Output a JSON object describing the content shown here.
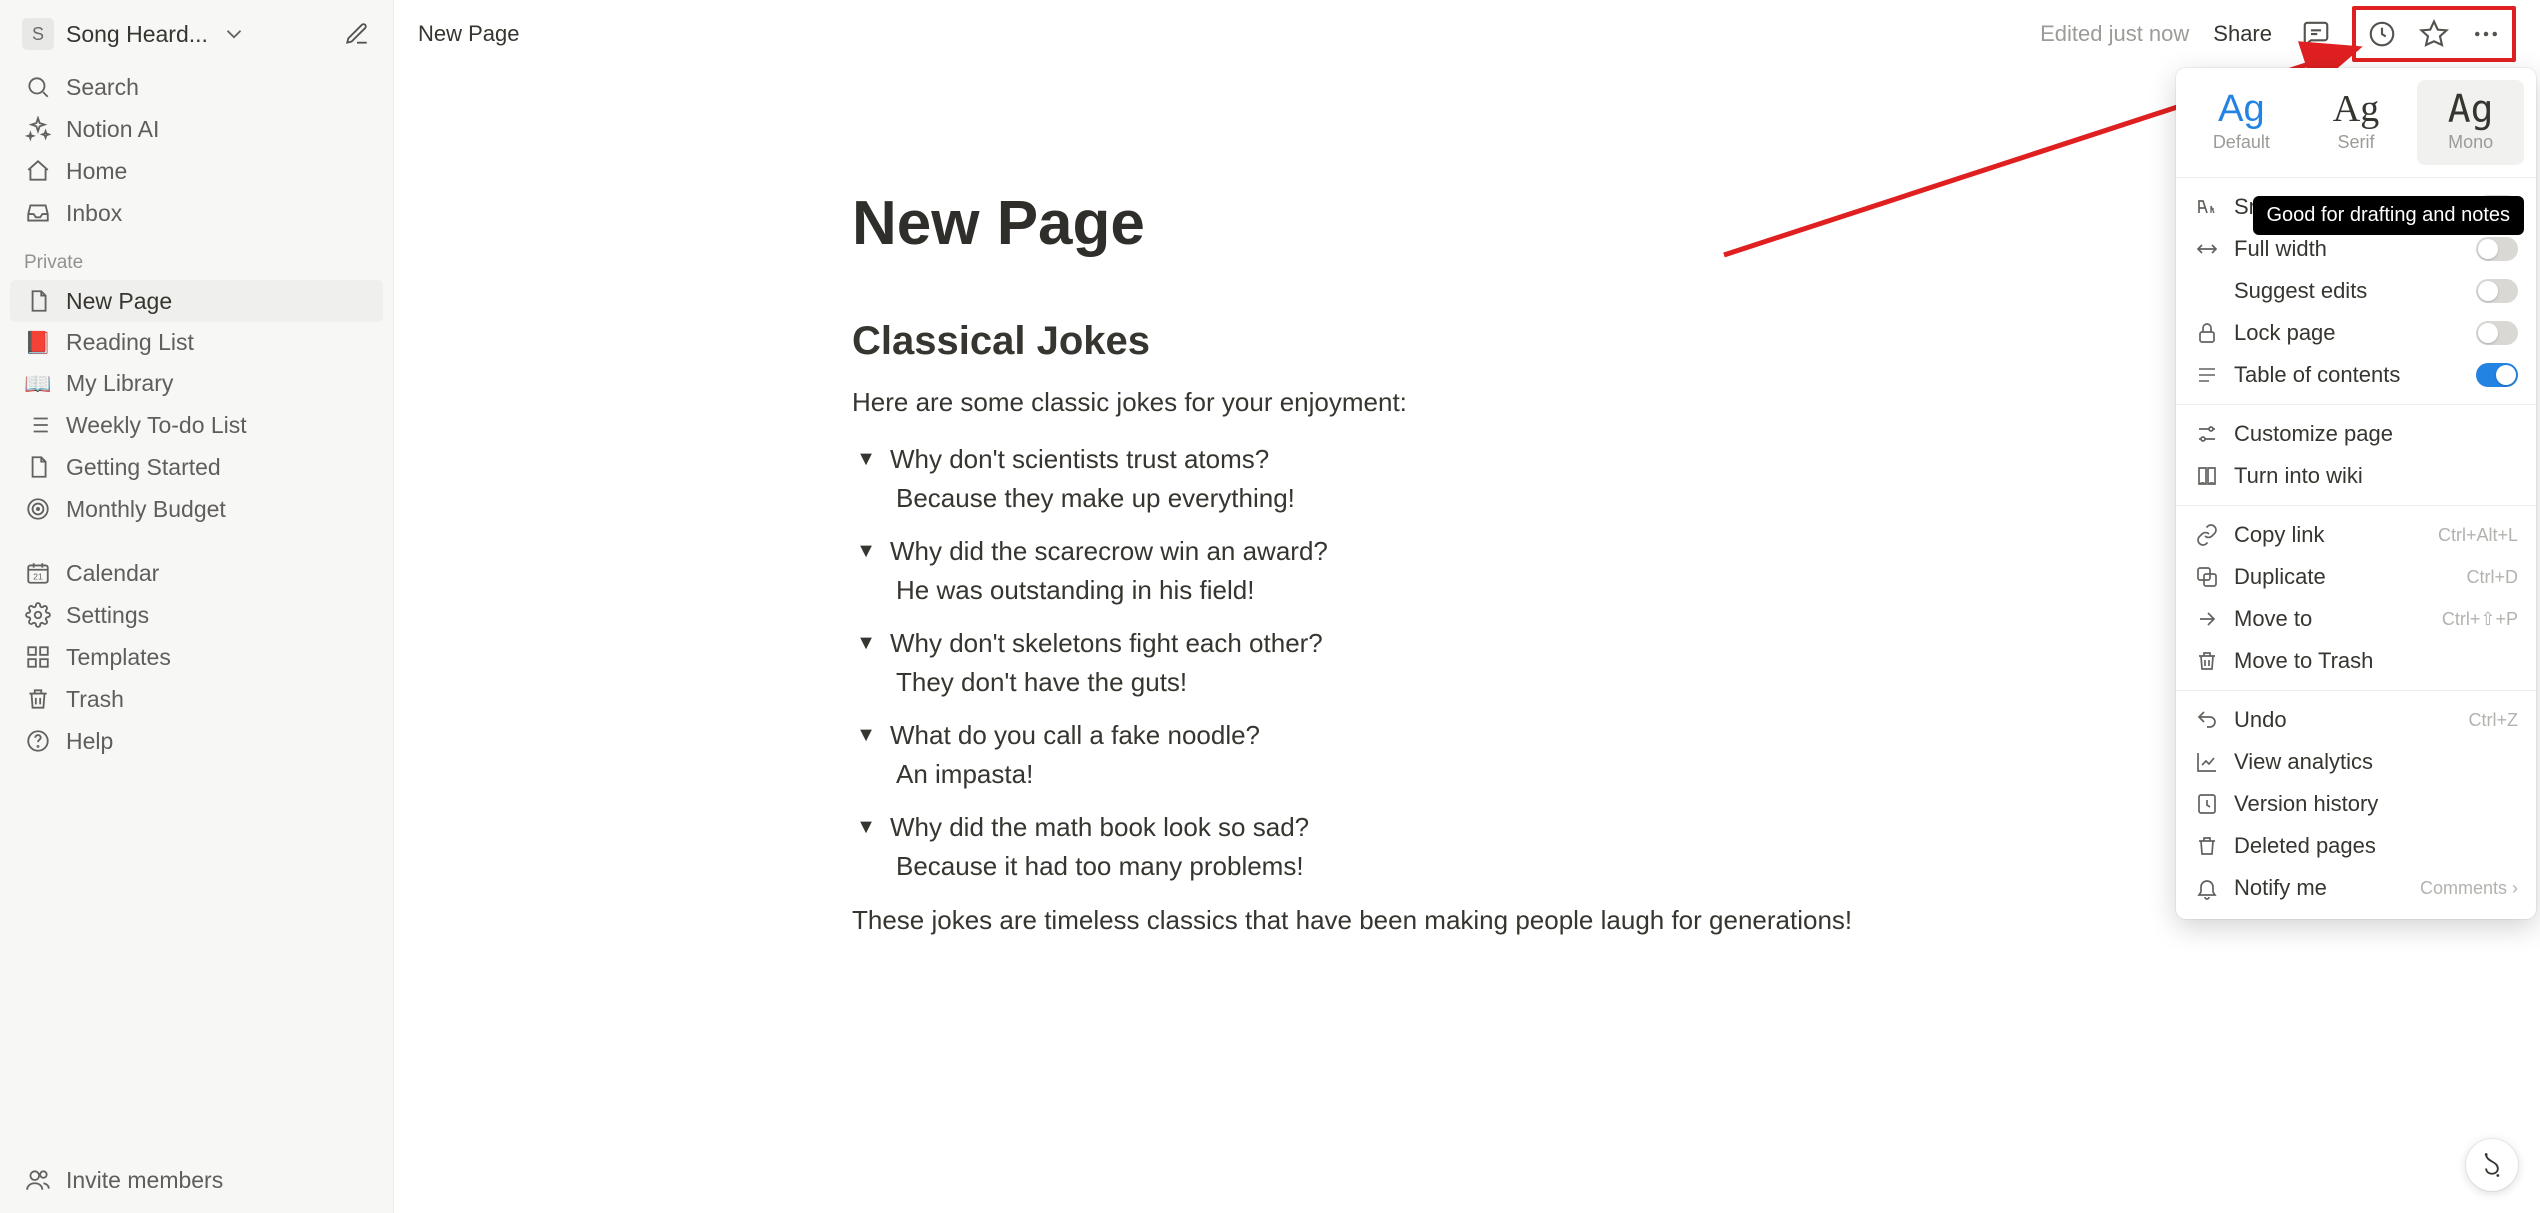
{
  "workspace": {
    "avatar_letter": "S",
    "name": "Song Heard..."
  },
  "sidebar": {
    "nav": [
      {
        "icon": "search",
        "label": "Search"
      },
      {
        "icon": "sparkles",
        "label": "Notion AI"
      },
      {
        "icon": "home",
        "label": "Home"
      },
      {
        "icon": "inbox",
        "label": "Inbox"
      }
    ],
    "section_label": "Private",
    "pages": [
      {
        "icon": "page",
        "label": "New Page",
        "active": true
      },
      {
        "icon": "emoji",
        "emoji": "📕",
        "label": "Reading List"
      },
      {
        "icon": "emoji",
        "emoji": "📖",
        "label": "My Library"
      },
      {
        "icon": "list",
        "label": "Weekly To-do List"
      },
      {
        "icon": "page",
        "label": "Getting Started"
      },
      {
        "icon": "target",
        "label": "Monthly Budget"
      }
    ],
    "bottom": [
      {
        "icon": "calendar",
        "label": "Calendar"
      },
      {
        "icon": "settings",
        "label": "Settings"
      },
      {
        "icon": "templates",
        "label": "Templates"
      },
      {
        "icon": "trash",
        "label": "Trash"
      },
      {
        "icon": "help",
        "label": "Help"
      }
    ],
    "footer": {
      "label": "Invite members"
    }
  },
  "topbar": {
    "breadcrumb": "New Page",
    "status": "Edited just now",
    "share": "Share"
  },
  "document": {
    "title": "New Page",
    "heading": "Classical Jokes",
    "intro": "Here are some classic jokes for your enjoyment:",
    "jokes": [
      {
        "q": "Why don't scientists trust atoms?",
        "a": "Because they make up everything!"
      },
      {
        "q": "Why did the scarecrow win an award?",
        "a": "He was outstanding in his field!"
      },
      {
        "q": "Why don't skeletons fight each other?",
        "a": "They don't have the guts!"
      },
      {
        "q": "What do you call a fake noodle?",
        "a": "An impasta!"
      },
      {
        "q": "Why did the math book look so sad?",
        "a": "Because it had too many problems!"
      }
    ],
    "outro": "These jokes are timeless classics that have been making people laugh for generations!"
  },
  "panel": {
    "fonts": {
      "default": "Default",
      "serif": "Serif",
      "mono": "Mono",
      "sample": "Ag"
    },
    "tooltip": "Good for drafting and notes",
    "toggles": [
      {
        "icon": "smalltext",
        "label": "Small text",
        "on": false
      },
      {
        "icon": "fullwidth",
        "label": "Full width",
        "on": false
      },
      {
        "icon": "suggest",
        "label": "Suggest edits",
        "on": false,
        "no_icon_gap": true
      },
      {
        "icon": "lock",
        "label": "Lock page",
        "on": false
      },
      {
        "icon": "toc",
        "label": "Table of contents",
        "on": true
      }
    ],
    "actions1": [
      {
        "icon": "customize",
        "label": "Customize page"
      },
      {
        "icon": "wiki",
        "label": "Turn into wiki"
      }
    ],
    "actions2": [
      {
        "icon": "link",
        "label": "Copy link",
        "hint": "Ctrl+Alt+L"
      },
      {
        "icon": "duplicate",
        "label": "Duplicate",
        "hint": "Ctrl+D"
      },
      {
        "icon": "moveto",
        "label": "Move to",
        "hint": "Ctrl+⇧+P"
      },
      {
        "icon": "trash",
        "label": "Move to Trash"
      }
    ],
    "actions3": [
      {
        "icon": "undo",
        "label": "Undo",
        "hint": "Ctrl+Z"
      },
      {
        "icon": "analytics",
        "label": "View analytics"
      },
      {
        "icon": "version",
        "label": "Version history"
      },
      {
        "icon": "deleted",
        "label": "Deleted pages"
      },
      {
        "icon": "bell",
        "label": "Notify me",
        "hint": "Comments  ›"
      }
    ]
  }
}
